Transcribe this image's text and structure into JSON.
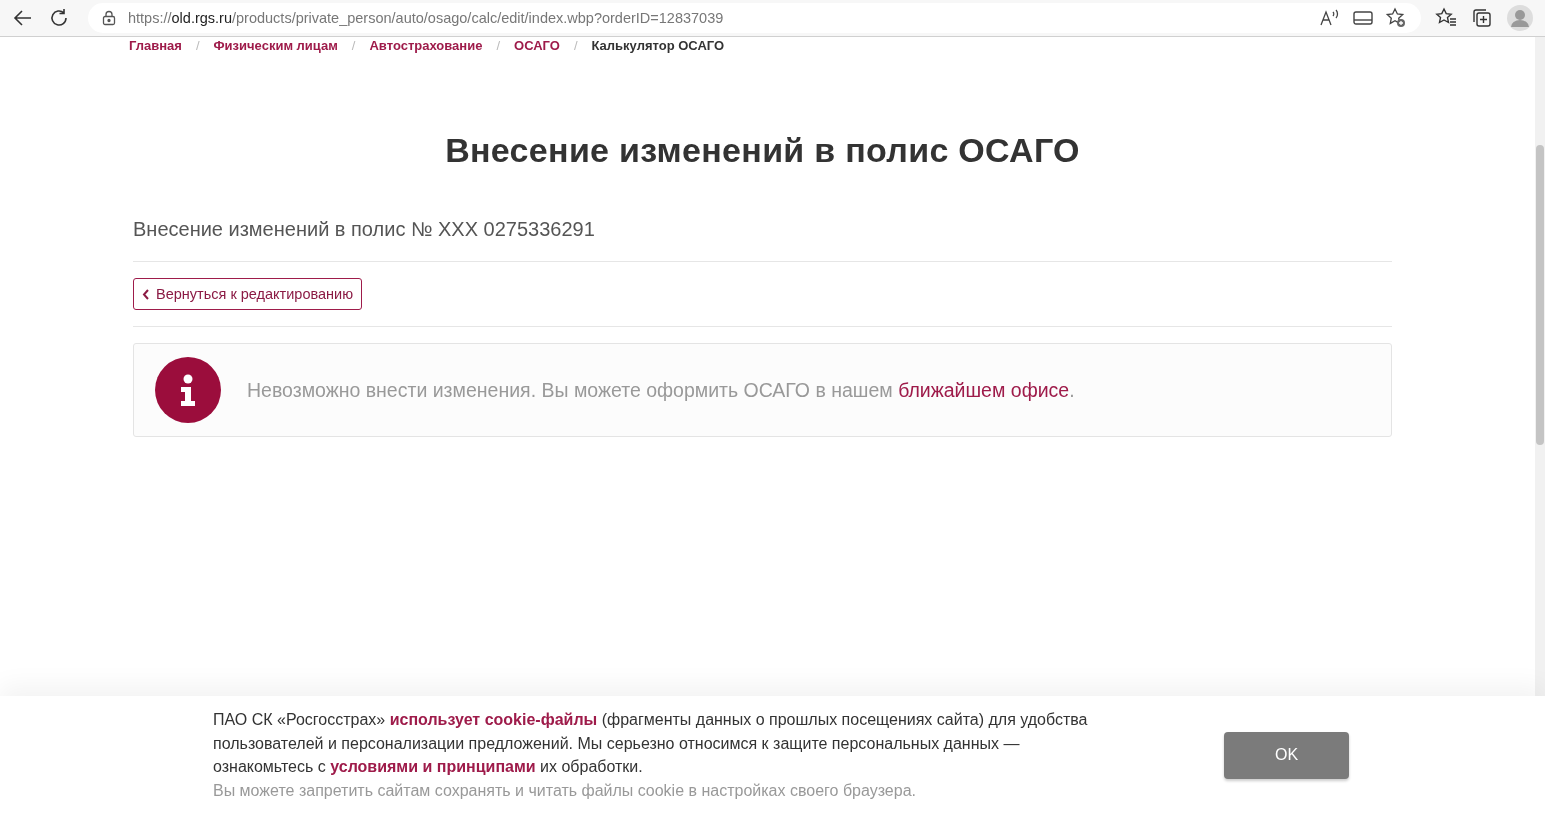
{
  "browser": {
    "url": {
      "scheme": "https://",
      "host": "old.rgs.ru",
      "path": "/products/private_person/auto/osago/calc/edit/index.wbp?orderID=12837039"
    }
  },
  "breadcrumbs": [
    {
      "label": "Главная",
      "current": false
    },
    {
      "separator": "/",
      "label": "Физическим лицам",
      "current": false
    },
    {
      "separator": "/",
      "label": "Автострахование",
      "current": false
    },
    {
      "separator": "/",
      "label": "ОСАГО",
      "current": false
    },
    {
      "separator": "/",
      "label": "Калькулятор ОСАГО",
      "current": true
    }
  ],
  "title": "Внесение изменений в полис ОСАГО",
  "subtitle": "Внесение изменений в полис № XXX 0275336291",
  "back_button": "Вернуться к редактированию",
  "notice": [
    {
      "kind": "text",
      "text": "Невозможно внести изменения. Вы можете оформить ОСАГО в нашем "
    },
    {
      "kind": "link",
      "text": "ближайшем офисе"
    },
    {
      "kind": "text",
      "text": "."
    }
  ],
  "cookie": {
    "message": [
      {
        "kind": "text",
        "text": "ПАО СК «Росгосстрах» "
      },
      {
        "kind": "link",
        "text": "использует cookie-файлы"
      },
      {
        "kind": "text",
        "text": " (фрагменты данных о прошлых посещениях сайта) для удобства пользователей и персонализации предложений. Мы серьезно относимся к защите персональных данных — ознакомьтесь с "
      },
      {
        "kind": "link",
        "text": "условиями и принципами"
      },
      {
        "kind": "text",
        "text": " их обработки."
      }
    ],
    "hint": "Вы можете запретить сайтам сохранять и читать файлы cookie в настройках своего браузера.",
    "button": "OK"
  }
}
